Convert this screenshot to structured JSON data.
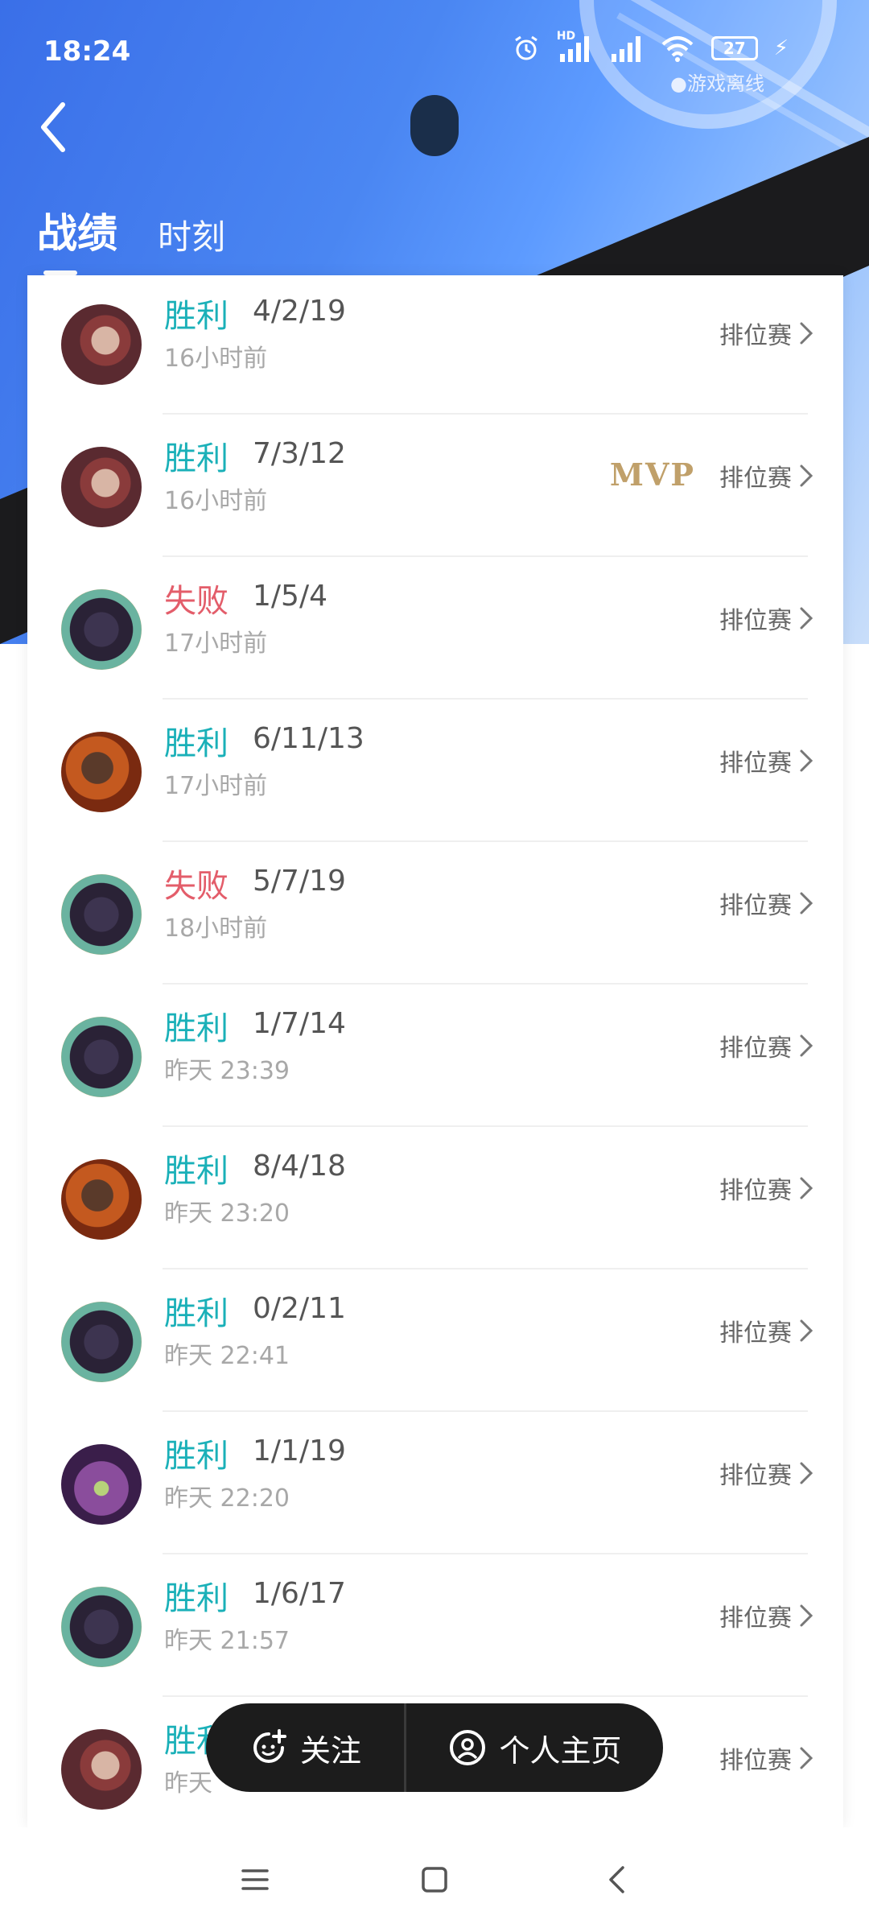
{
  "status_bar": {
    "time": "18:24",
    "battery": "27",
    "network": "HD",
    "game_status": "●游戏离线"
  },
  "tabs": [
    {
      "label": "战绩",
      "active": true
    },
    {
      "label": "时刻",
      "active": false
    }
  ],
  "colors": {
    "win": "#1ab0b8",
    "lose": "#e35d6a",
    "mvp": "#c0a06a"
  },
  "matches": [
    {
      "result": "胜利",
      "outcome": "win",
      "kda": "4/2/19",
      "time": "16小时前",
      "mode": "排位赛",
      "mvp": "",
      "hero": "hero-red-hair"
    },
    {
      "result": "胜利",
      "outcome": "win",
      "kda": "7/3/12",
      "time": "16小时前",
      "mode": "排位赛",
      "mvp": "MVP",
      "hero": "hero-red-hair"
    },
    {
      "result": "失败",
      "outcome": "lose",
      "kda": "1/5/4",
      "time": "17小时前",
      "mode": "排位赛",
      "mvp": "",
      "hero": "hero-mustache"
    },
    {
      "result": "胜利",
      "outcome": "win",
      "kda": "6/11/13",
      "time": "17小时前",
      "mode": "排位赛",
      "mvp": "",
      "hero": "hero-fire"
    },
    {
      "result": "失败",
      "outcome": "lose",
      "kda": "5/7/19",
      "time": "18小时前",
      "mode": "排位赛",
      "mvp": "",
      "hero": "hero-mustache"
    },
    {
      "result": "胜利",
      "outcome": "win",
      "kda": "1/7/14",
      "time": "昨天 23:39",
      "mode": "排位赛",
      "mvp": "",
      "hero": "hero-mustache"
    },
    {
      "result": "胜利",
      "outcome": "win",
      "kda": "8/4/18",
      "time": "昨天 23:20",
      "mode": "排位赛",
      "mvp": "",
      "hero": "hero-fire"
    },
    {
      "result": "胜利",
      "outcome": "win",
      "kda": "0/2/11",
      "time": "昨天 22:41",
      "mode": "排位赛",
      "mvp": "",
      "hero": "hero-mustache"
    },
    {
      "result": "胜利",
      "outcome": "win",
      "kda": "1/1/19",
      "time": "昨天 22:20",
      "mode": "排位赛",
      "mvp": "",
      "hero": "hero-purple-girl"
    },
    {
      "result": "胜利",
      "outcome": "win",
      "kda": "1/6/17",
      "time": "昨天 21:57",
      "mode": "排位赛",
      "mvp": "",
      "hero": "hero-mustache"
    },
    {
      "result": "胜利",
      "outcome": "win",
      "kda": "",
      "time": "昨天",
      "mode": "排位赛",
      "mvp": "",
      "hero": "hero-red-hair"
    }
  ],
  "float_bar": {
    "follow_label": "关注",
    "profile_label": "个人主页"
  }
}
